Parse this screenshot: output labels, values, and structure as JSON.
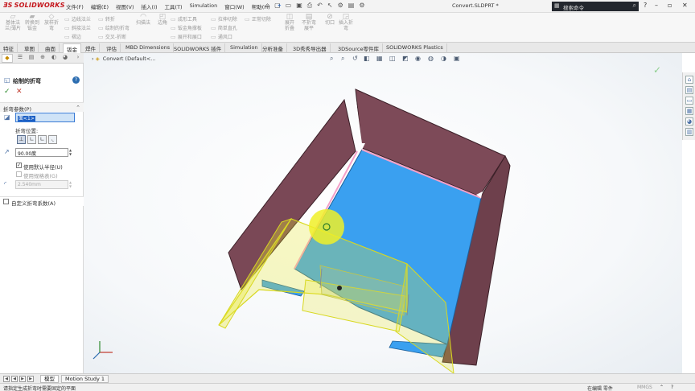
{
  "app": {
    "logo": "SOLIDWORKS",
    "document_title": "Convert.SLDPRT *"
  },
  "menu": [
    "文件(F)",
    "编辑(E)",
    "视图(V)",
    "插入(I)",
    "工具(T)",
    "Simulation",
    "窗口(W)",
    "帮助(H)"
  ],
  "search": {
    "placeholder": "搜索命令"
  },
  "ribbon": {
    "big": [
      {
        "label1": "基体法",
        "label2": "兰/薄片"
      },
      {
        "label1": "转换到",
        "label2": "钣金"
      },
      {
        "label1": "放样折",
        "label2": "弯"
      },
      {
        "label1": "边角",
        "label2": ""
      },
      {
        "label1": "扫描法",
        "label2": ""
      },
      {
        "label1": "展开",
        "label2": ""
      },
      {
        "label1": "不折弯",
        "label2": ""
      },
      {
        "label1": "切口",
        "label2": ""
      },
      {
        "label1": "插入折",
        "label2": "弯"
      }
    ],
    "small": [
      "边线法兰",
      "斜接法兰",
      "褶边",
      "转折",
      "绘制的折弯",
      "交叉-折断",
      "成形工具",
      "钣金角撑板",
      "展开和展口",
      "拉伸切除",
      "简单直孔",
      "通风口",
      "正常切除",
      "折叠",
      "展平"
    ]
  },
  "cmd_tabs": [
    "特征",
    "草图",
    "曲面",
    "钣金",
    "焊件",
    "评估",
    "MBD Dimensions",
    "SOLIDWORKS 插件",
    "Simulation",
    "分析准备",
    "3D秀秀导出器",
    "3DSource零件库",
    "SOLIDWORKS Plastics"
  ],
  "cmd_tab_active": "钣金",
  "property_manager": {
    "title": "绘制的折弯",
    "ok": "✓",
    "cancel": "✕",
    "section_params": "折弯参数(P)",
    "face_value": "面<1>",
    "bend_position_label": "折弯位置:",
    "angle_value": "90.00度",
    "use_default_radius": "使用默认半径(U)",
    "use_gauge_table": "使用规格表(G)",
    "radius_value": "2.540mm",
    "custom_bend_allowance": "自定义折弯系数(A)"
  },
  "tree": {
    "name": "Convert",
    "suffix": "(Default<..."
  },
  "bottom_tabs": [
    "模型",
    "Motion Study 1"
  ],
  "bottom_tab_active": "模型",
  "status": {
    "message": "请指定生成折弯时需要固定的平面",
    "editing": "在编辑 零件",
    "units": "MMGS"
  },
  "colors": {
    "accent": "#2b6cb0",
    "blue_face": "#3aa0f0",
    "wall": "#7a4856",
    "preview_yellow": "#e8e830"
  },
  "icons": {
    "ok": "check-icon",
    "cancel": "close-icon",
    "help": "help-icon",
    "rotate": "rotate-icon"
  }
}
